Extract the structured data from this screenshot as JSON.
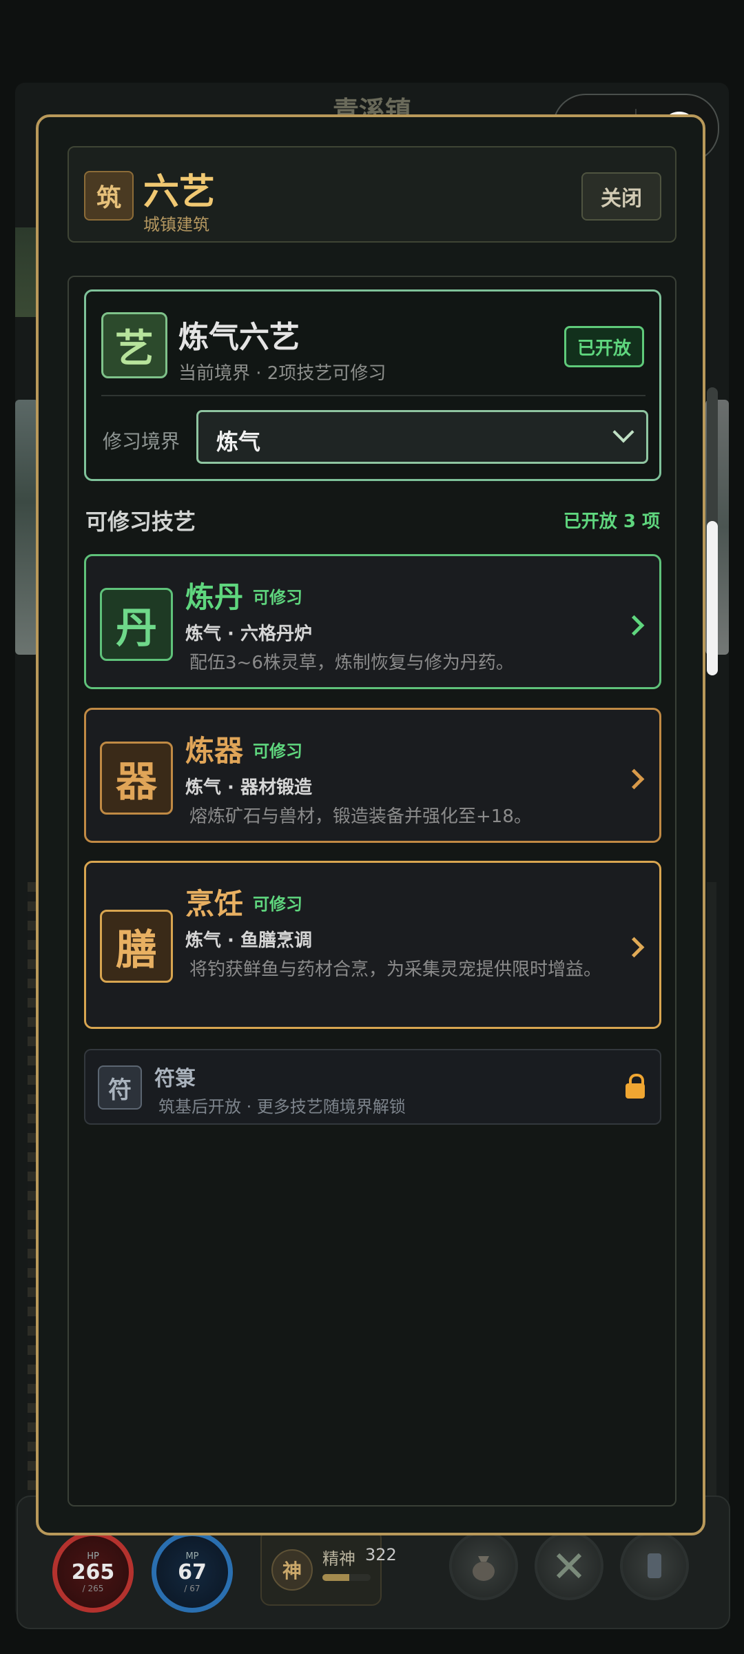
{
  "background": {
    "town_title": "青溪镇"
  },
  "modal": {
    "header": {
      "icon_char": "筑",
      "title": "六艺",
      "subtitle": "城镇建筑",
      "close_label": "关闭"
    },
    "realm_panel": {
      "icon_char": "艺",
      "name": "炼气六艺",
      "description": "当前境界 · 2项技艺可修习",
      "status": "已开放",
      "field_label": "修习境界",
      "selected_realm": "炼气"
    },
    "section": {
      "title": "可修习技艺",
      "count_label": "已开放 3 项"
    },
    "crafts": [
      {
        "icon_char": "丹",
        "name": "炼丹",
        "tag": "可修习",
        "meta": "炼气 · 六格丹炉",
        "description": "配伍3~6株灵草，炼制恢复与修为丹药。",
        "accent": "#5fd67e"
      },
      {
        "icon_char": "器",
        "name": "炼器",
        "tag": "可修习",
        "meta": "炼气 · 器材锻造",
        "description": "熔炼矿石与兽材，锻造装备并强化至+18。",
        "accent": "#d89a4a"
      },
      {
        "icon_char": "膳",
        "name": "烹饪",
        "tag": "可修习",
        "meta": "炼气 · 鱼膳烹调",
        "description": "将钓获鲜鱼与药材合烹，为采集灵宠提供限时增益。",
        "accent": "#e0aa56"
      }
    ],
    "locked_craft": {
      "icon_char": "符",
      "name": "符箓",
      "description": "筑基后开放 · 更多技艺随境界解锁",
      "icon": "lock-icon"
    }
  },
  "hud": {
    "hp": {
      "label": "HP",
      "value": "265",
      "max": "/ 265"
    },
    "mp": {
      "label": "MP",
      "value": "67",
      "max": "/ 67"
    },
    "spirit": {
      "badge": "神",
      "label": "精神",
      "value": "322",
      "fill": 0.55
    },
    "buttons": [
      "bag-icon",
      "combat-icon",
      "phone-icon"
    ]
  },
  "colors": {
    "modal_border": "#b9995a",
    "title_gold": "#f0c872",
    "open_green": "#5fd67e"
  }
}
